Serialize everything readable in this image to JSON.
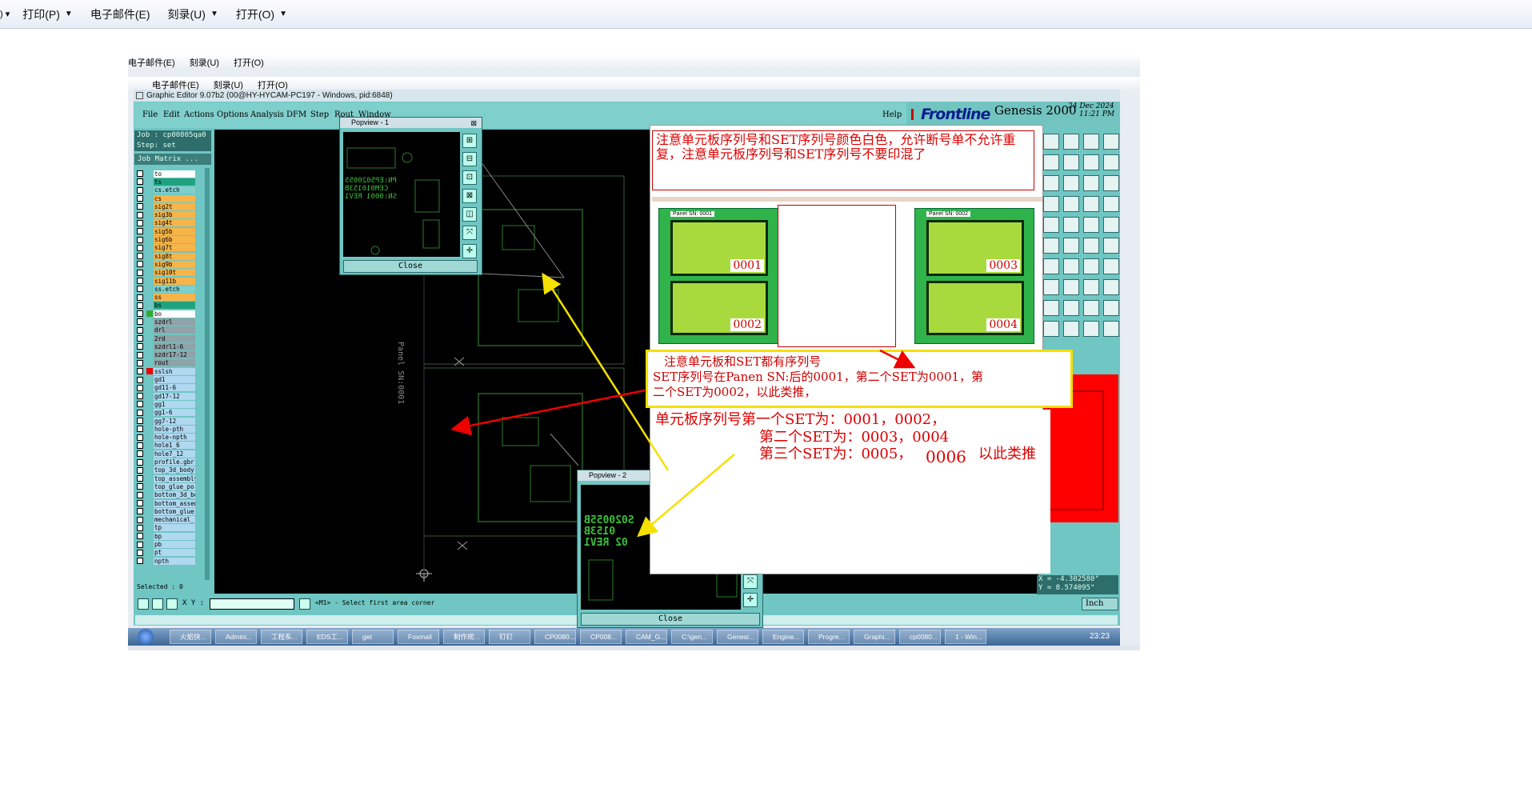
{
  "topbar": {
    "items": [
      "打印(P)",
      "电子邮件(E)",
      "刻录(U)",
      "打开(O)"
    ]
  },
  "inner_bar1": {
    "items": [
      "电子邮件(E)",
      "刻录(U)",
      "打开(O)"
    ]
  },
  "inner_bar2": {
    "items": [
      "电子邮件(E)",
      "刻录(U)",
      "打开(O)"
    ]
  },
  "app": {
    "title": "Graphic Editor 9.07b2 (00@HY-HYCAM-PC197 - Windows, pid:6848)",
    "menu": [
      "File",
      "Edit",
      "Actions",
      "Options",
      "Analysis",
      "DFM",
      "Step",
      "Rout",
      "Window"
    ],
    "help": "Help",
    "brand": "Frontline",
    "product": "Genesis 2000",
    "date": "24 Dec 2024",
    "time": "11:21 PM"
  },
  "job": {
    "job_line": "Job : cp00805qa0",
    "step_line": "Step: set",
    "matrix": "Job Matrix ..."
  },
  "layers": [
    {
      "name": "to",
      "color": "#ffffff"
    },
    {
      "name": "ts",
      "color": "#1fa37f"
    },
    {
      "name": "cs.etch",
      "color": "#7fcfcc"
    },
    {
      "name": "cs",
      "color": "#f6b449"
    },
    {
      "name": "sig2t",
      "color": "#f6b449"
    },
    {
      "name": "sig3b",
      "color": "#f6b449"
    },
    {
      "name": "sig4t",
      "color": "#f6b449"
    },
    {
      "name": "sig5b",
      "color": "#f6b449"
    },
    {
      "name": "sig6b",
      "color": "#f6b449"
    },
    {
      "name": "sig7t",
      "color": "#f6b449"
    },
    {
      "name": "sig8t",
      "color": "#f6b449"
    },
    {
      "name": "sig9b",
      "color": "#f6b449"
    },
    {
      "name": "sig10t",
      "color": "#f6b449"
    },
    {
      "name": "sig11b",
      "color": "#f6b449"
    },
    {
      "name": "ss.etch",
      "color": "#7fcfcc"
    },
    {
      "name": "ss",
      "color": "#f6b449"
    },
    {
      "name": "bs",
      "color": "#1fa37f"
    },
    {
      "name": "bo",
      "color": "#ffffff"
    },
    {
      "name": "szdrl",
      "color": "#8fa3a8"
    },
    {
      "name": "drl",
      "color": "#8fa3a8"
    },
    {
      "name": "2rd",
      "color": "#8fa3a8"
    },
    {
      "name": "szdrl1-6",
      "color": "#8fa3a8"
    },
    {
      "name": "szdr17-12",
      "color": "#8fa3a8"
    },
    {
      "name": "rout",
      "color": "#8fa3a8"
    },
    {
      "name": "sslsh",
      "color": "#b0d8f0"
    },
    {
      "name": "gd1",
      "color": "#b0d8f0"
    },
    {
      "name": "gd11-6",
      "color": "#b0d8f0"
    },
    {
      "name": "gd17-12",
      "color": "#b0d8f0"
    },
    {
      "name": "gg1",
      "color": "#b0d8f0"
    },
    {
      "name": "gg1-6",
      "color": "#b0d8f0"
    },
    {
      "name": "gg7-12",
      "color": "#b0d8f0"
    },
    {
      "name": "hole-pth",
      "color": "#b0d8f0"
    },
    {
      "name": "hole-npth",
      "color": "#b0d8f0"
    },
    {
      "name": "hole1_6",
      "color": "#b0d8f0"
    },
    {
      "name": "hole7_12",
      "color": "#b0d8f0"
    },
    {
      "name": "profile.gbr",
      "color": "#b0d8f0"
    },
    {
      "name": "top_3d_body",
      "color": "#b0d8f0"
    },
    {
      "name": "top_assembly",
      "color": "#b0d8f0"
    },
    {
      "name": "top_glue_po",
      "color": "#b0d8f0"
    },
    {
      "name": "bottom_3d_bo",
      "color": "#b0d8f0"
    },
    {
      "name": "bottom_assen",
      "color": "#b0d8f0"
    },
    {
      "name": "bottom_glue",
      "color": "#b0d8f0"
    },
    {
      "name": "mechanical_",
      "color": "#b0d8f0"
    },
    {
      "name": "tp",
      "color": "#b0d8f0"
    },
    {
      "name": "bp",
      "color": "#b0d8f0"
    },
    {
      "name": "pb",
      "color": "#b0d8f0"
    },
    {
      "name": "pt",
      "color": "#b0d8f0"
    },
    {
      "name": "npth",
      "color": "#b0d8f0"
    }
  ],
  "selected": "Selected : 0",
  "popup1": {
    "title": "Popview - 1",
    "close": "Close",
    "text_lines": [
      "PN:EP5020055",
      "CEM010153B",
      "SN:0001 REV1"
    ]
  },
  "popup2": {
    "title": "Popview - 2",
    "close": "Close",
    "text_lines": [
      "S020055B",
      "0153B",
      "02 REV1"
    ]
  },
  "canvas": {
    "panel_label": "Panel SN:0001"
  },
  "coords": {
    "x": "X = -4.302580\"",
    "y": "Y = 8.574095\""
  },
  "bottom": {
    "xy_label": "X Y :",
    "status": "<M1> - Select first area corner",
    "unit": "Inch"
  },
  "annotations": {
    "note1": "注意单元板序列号和SET序列号颜色白色，允许断号单不允许重复，注意单元板序列号和SET序列号不要印混了",
    "note2_l1": "注意单元板和SET都有序列号",
    "note2_l2": "SET序列号在Panen SN:后的0001，第二个SET为0001，第",
    "note2_l3": "二个SET为0002，以此类推，",
    "note3_l1": "单元板序列号第一个SET为：0001，0002，",
    "note3_l2": "第二个SET为：0003，0004",
    "note3_l3": "第三个SET为：0005，",
    "note3_l3b": "0006",
    "note3_l3c": "以此类推"
  },
  "panels": [
    {
      "label": "Panel SN: 0001",
      "units": [
        "0001",
        "0002"
      ]
    },
    {
      "label": "Panel SN: 0002",
      "units": [
        "0003",
        "0004"
      ]
    }
  ],
  "taskbar": {
    "items": [
      "火焰快...",
      "Admini...",
      "工程系...",
      "EDS工...",
      "get",
      "Foxmail",
      "制作规...",
      "钉钉",
      "CP0080...",
      "CP008...",
      "CAM_G...",
      "C:\\gen...",
      "Genesi...",
      "Engine...",
      "Progre...",
      "Graphi...",
      "cp0080...",
      "1 - Win..."
    ],
    "clock": "23:23"
  },
  "colors": {
    "app_bg": "#6fc6c3",
    "canvas": "#000000",
    "annotation_red": "#d00000",
    "highlight_yellow": "#f5e000",
    "panel_green": "#2fb34a",
    "unit_green": "#a8d93d"
  }
}
